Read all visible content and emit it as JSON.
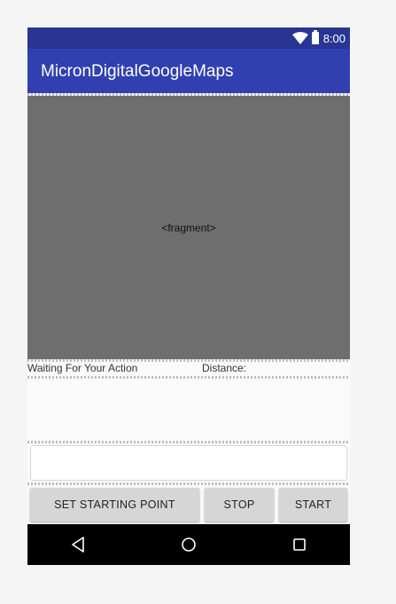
{
  "status_bar": {
    "time": "8:00",
    "icons": [
      "wifi-icon",
      "battery-icon"
    ],
    "color": "#283593"
  },
  "app_bar": {
    "title": "MicronDigitalGoogleMaps",
    "color": "#3140b0"
  },
  "map": {
    "placeholder": "<fragment>",
    "background": "#6e6e6e"
  },
  "info": {
    "status_text": "Waiting For Your Action",
    "distance_label": "Distance:"
  },
  "input": {
    "value": "",
    "placeholder": ""
  },
  "buttons": {
    "set_starting_point": "SET STARTING POINT",
    "stop": "STOP",
    "start": "START"
  },
  "nav_bar": {
    "icons": [
      "back-icon",
      "home-icon",
      "recents-icon"
    ]
  }
}
